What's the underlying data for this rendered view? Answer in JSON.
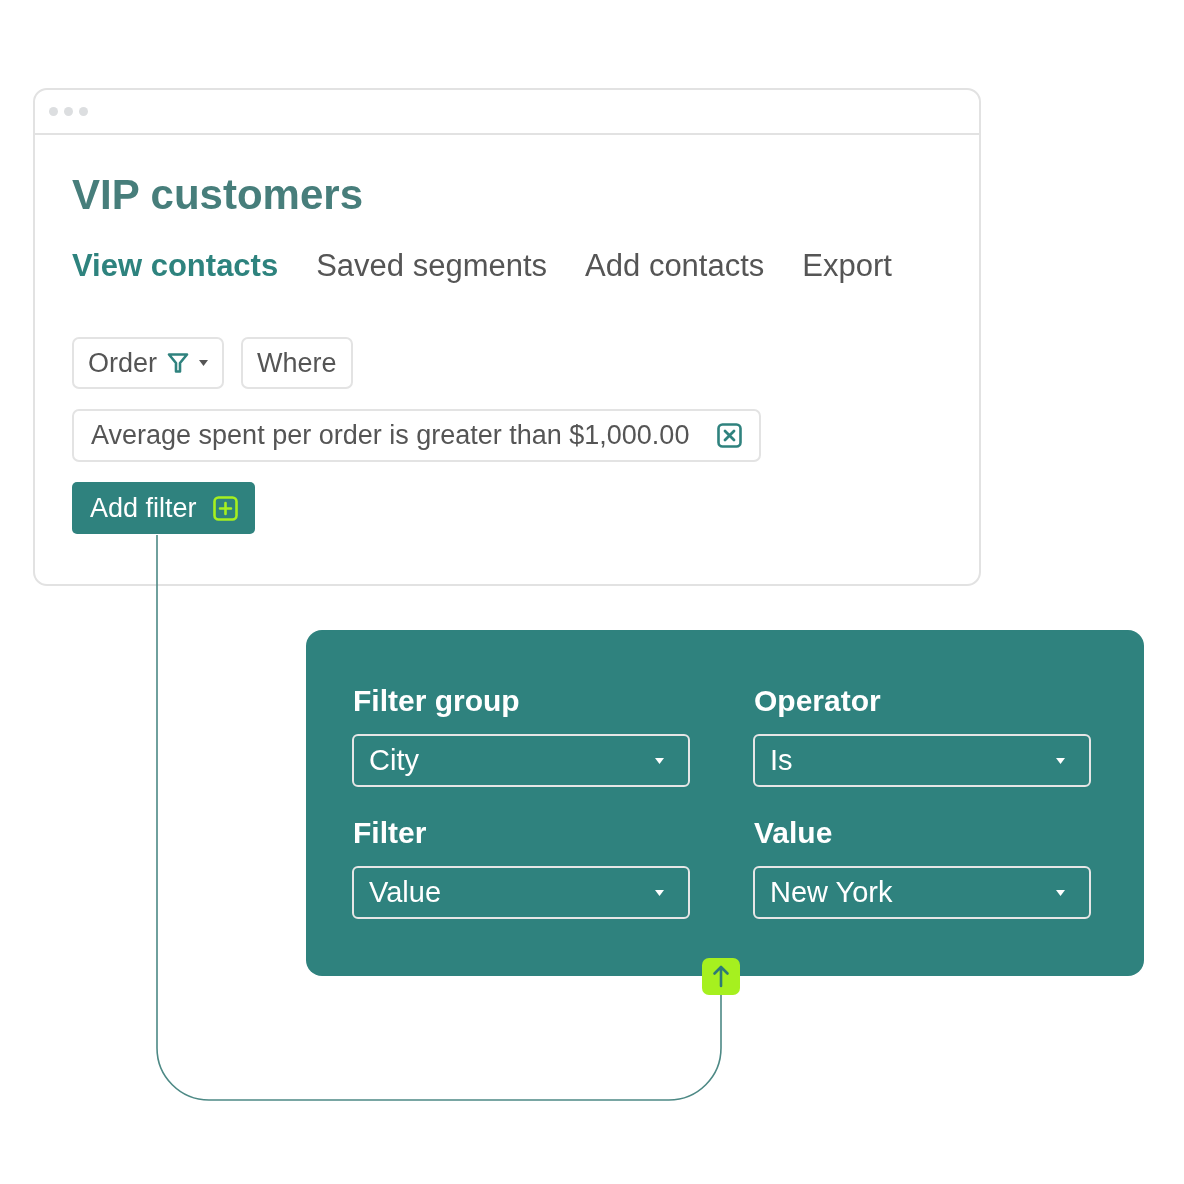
{
  "window": {
    "title": "VIP customers"
  },
  "tabs": [
    {
      "label": "View contacts",
      "selected": true
    },
    {
      "label": "Saved segments",
      "selected": false
    },
    {
      "label": "Add contacts",
      "selected": false
    },
    {
      "label": "Export",
      "selected": false
    }
  ],
  "query_buttons": [
    {
      "label": "Order",
      "kind": "dropdown"
    },
    {
      "label": "Where",
      "kind": "plain"
    }
  ],
  "active_filter": {
    "text": "Average spent per order is greater than $1,000.00"
  },
  "add_filter_button": {
    "label": "Add filter"
  },
  "filter_panel": {
    "fields": [
      {
        "label": "Filter group",
        "value": "City"
      },
      {
        "label": "Operator",
        "value": "Is"
      },
      {
        "label": "Filter",
        "value": "Value"
      },
      {
        "label": "Value",
        "value": "New York"
      }
    ]
  }
}
